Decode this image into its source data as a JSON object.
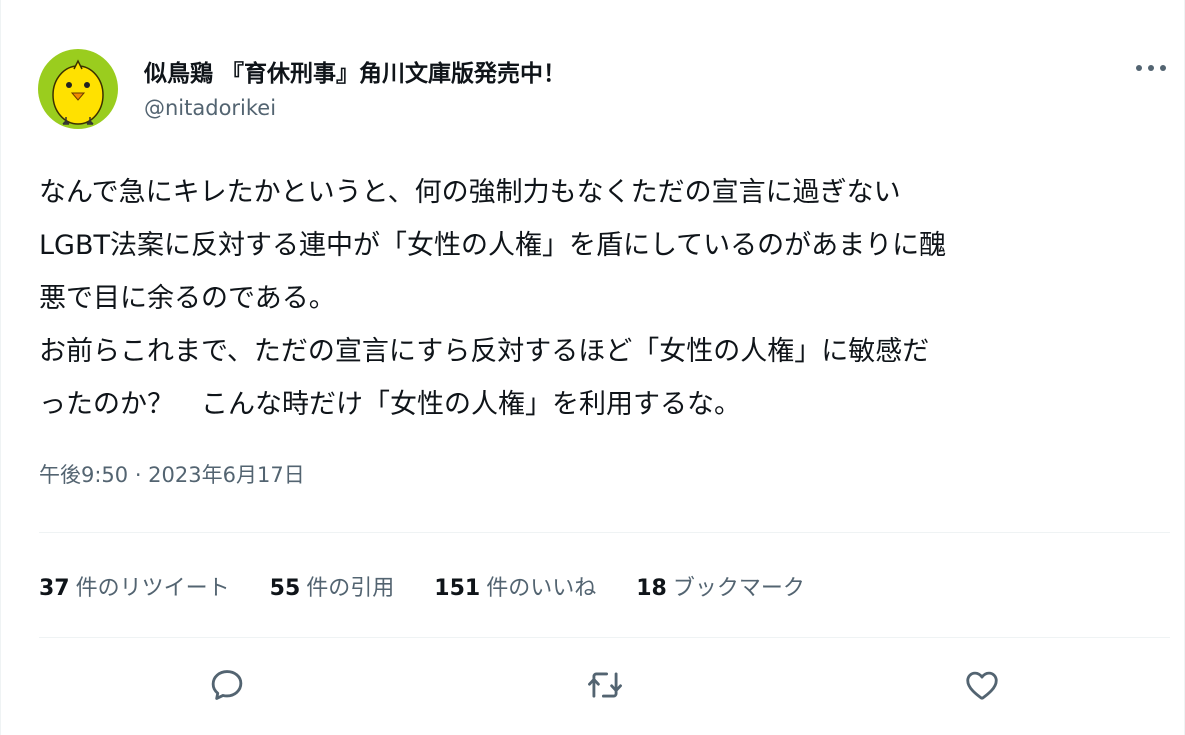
{
  "author": {
    "name": "似鳥鶏 『育休刑事』角川文庫版発売中！",
    "handle": "@nitadorikei",
    "avatar_icon": "chick-avatar-icon"
  },
  "more_icon": "more-dots-icon",
  "tweet": {
    "lines": [
      "なんで急にキレたかというと、何の強制力もなくただの宣言に過ぎない",
      "LGBT法案に反対する連中が「女性の人権」を盾にしているのがあまりに醜",
      "悪で目に余るのである。",
      "お前らこれまで、ただの宣言にすら反対するほど「女性の人権」に敏感だ",
      "ったのか？　こんな時だけ「女性の人権」を利用するな。"
    ],
    "timestamp": "午後9:50 · 2023年6月17日"
  },
  "stats": {
    "retweets": {
      "count": "37",
      "label": "件のリツイート"
    },
    "quotes": {
      "count": "55",
      "label": "件の引用"
    },
    "likes": {
      "count": "151",
      "label": "件のいいね"
    },
    "bookmarks": {
      "count": "18",
      "label": "ブックマーク"
    }
  },
  "actions": {
    "reply_icon": "reply-icon",
    "retweet_icon": "retweet-icon",
    "like_icon": "heart-icon"
  },
  "colors": {
    "avatar_bg": "#9acd1e",
    "chick": "#ffe100",
    "secondary_text": "#536471",
    "divider": "#eff3f4"
  }
}
